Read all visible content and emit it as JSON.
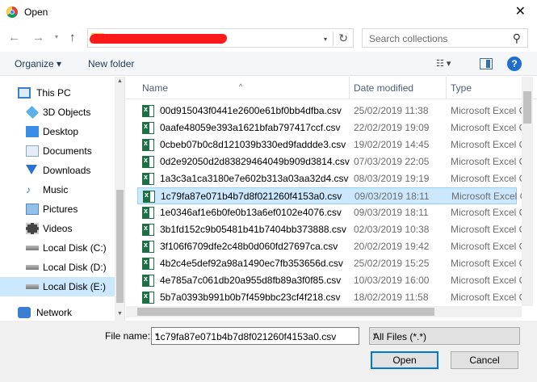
{
  "window": {
    "title": "Open",
    "close_glyph": "✕",
    "app_icon": "chrome-icon"
  },
  "nav": {
    "back_glyph": "←",
    "forward_glyph": "→",
    "recent_glyph": "▾",
    "up_glyph": "↑",
    "address_path": "",
    "refresh_glyph": "↻",
    "dropdown_glyph": "▾",
    "search_placeholder": "Search collections",
    "search_glyph": "⚲"
  },
  "toolbar": {
    "organize_label": "Organize ▾",
    "new_folder_label": "New folder",
    "view_glyph": "☷ ▾",
    "help_glyph": "?"
  },
  "sidebar": {
    "items": [
      {
        "label": "This PC",
        "icon": "computer-icon"
      },
      {
        "label": "3D Objects",
        "icon": "cube-icon"
      },
      {
        "label": "Desktop",
        "icon": "desktop-icon"
      },
      {
        "label": "Documents",
        "icon": "documents-icon"
      },
      {
        "label": "Downloads",
        "icon": "download-arrow-icon"
      },
      {
        "label": "Music",
        "icon": "music-note-icon"
      },
      {
        "label": "Pictures",
        "icon": "pictures-icon"
      },
      {
        "label": "Videos",
        "icon": "film-icon"
      },
      {
        "label": "Local Disk (C:)",
        "icon": "drive-icon"
      },
      {
        "label": "Local Disk (D:)",
        "icon": "drive-icon"
      },
      {
        "label": "Local Disk (E:)",
        "icon": "drive-icon"
      },
      {
        "label": "Network",
        "icon": "network-icon"
      }
    ],
    "selected_index": 10
  },
  "columns": {
    "name": "Name",
    "date": "Date modified",
    "type": "Type",
    "sort_glyph": "^"
  },
  "files": [
    {
      "name": "00d915043f0441e2600e61bf0bb4dfba.csv",
      "date": "25/02/2019 11:38",
      "type": "Microsoft Excel C"
    },
    {
      "name": "0aafe48059e393a1621bfab797417ccf.csv",
      "date": "22/02/2019 19:09",
      "type": "Microsoft Excel C"
    },
    {
      "name": "0cbeb07b0c8d121039b330ed9faddde3.csv",
      "date": "19/02/2019 14:45",
      "type": "Microsoft Excel C"
    },
    {
      "name": "0d2e92050d2d83829464049b909d3814.csv",
      "date": "07/03/2019 22:05",
      "type": "Microsoft Excel C"
    },
    {
      "name": "1a3c3a1ca3180e7e602b313a03aa32d4.csv",
      "date": "08/03/2019 19:19",
      "type": "Microsoft Excel C"
    },
    {
      "name": "1c79fa87e071b4b7d8f021260f4153a0.csv",
      "date": "09/03/2019 18:11",
      "type": "Microsoft Excel C"
    },
    {
      "name": "1e0346af1e6b0fe0b13a6ef0102e4076.csv",
      "date": "09/03/2019 18:11",
      "type": "Microsoft Excel C"
    },
    {
      "name": "3b1fd152c9b05481b41b7404bb373888.csv",
      "date": "02/03/2019 10:38",
      "type": "Microsoft Excel C"
    },
    {
      "name": "3f106f6709dfe2c48b0d060fd27697ca.csv",
      "date": "20/02/2019 19:42",
      "type": "Microsoft Excel C"
    },
    {
      "name": "4b2c4e5def92a98a1490ec7fb353656d.csv",
      "date": "25/02/2019 15:25",
      "type": "Microsoft Excel C"
    },
    {
      "name": "4e785a7c061db20a955d8fb89a3f0f85.csv",
      "date": "10/03/2019 16:00",
      "type": "Microsoft Excel C"
    },
    {
      "name": "5b7a0393b991b0b7f459bbc23cf4f218.csv",
      "date": "18/02/2019 11:58",
      "type": "Microsoft Excel C"
    }
  ],
  "selected_file_index": 5,
  "footer": {
    "file_name_label": "File name:",
    "file_name_value": "1c79fa87e071b4b7d8f021260f4153a0.csv",
    "file_type_value": "All Files (*.*)",
    "dropdown_glyph": "▾",
    "open_label": "Open",
    "cancel_label": "Cancel"
  },
  "colors": {
    "selection": "#cce8ff",
    "accent": "#0078d7",
    "excel_green": "#1d7044"
  }
}
